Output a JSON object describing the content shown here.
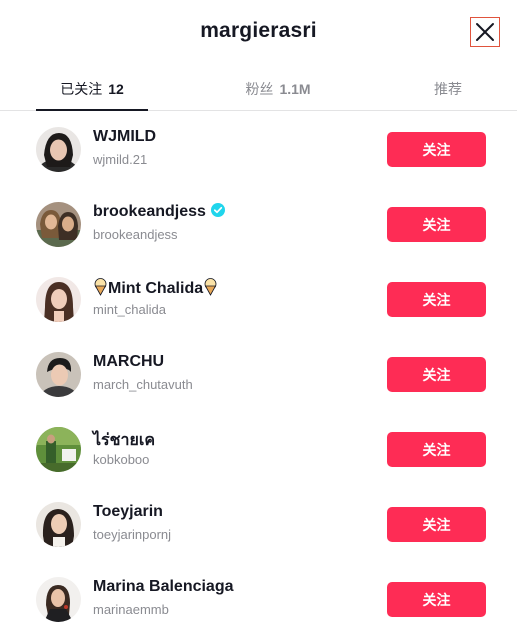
{
  "dialog": {
    "title": "margierasri",
    "close_icon": "close-icon"
  },
  "tabs": [
    {
      "label": "已关注",
      "count": "12",
      "active": true
    },
    {
      "label": "粉丝",
      "count": "1.1M",
      "active": false
    },
    {
      "label": "推荐",
      "count": "",
      "active": false
    }
  ],
  "users": [
    {
      "name": "WJMILD",
      "handle": "wjmild.21",
      "verified": false,
      "button": "关注"
    },
    {
      "name": "brookeandjess",
      "handle": "brookeandjess",
      "verified": true,
      "button": "关注"
    },
    {
      "name": "Mint Chalida",
      "handle": "mint_chalida",
      "verified": false,
      "button": "关注",
      "emoji": "ice-cream-icon"
    },
    {
      "name": "MARCHU",
      "handle": "march_chutavuth",
      "verified": false,
      "button": "关注"
    },
    {
      "name": "ไร่ชายเค",
      "handle": "kobkoboo",
      "verified": false,
      "button": "关注"
    },
    {
      "name": "Toeyjarin",
      "handle": "toeyjarinpornj",
      "verified": false,
      "button": "关注"
    },
    {
      "name": "Marina Balenciaga",
      "handle": "marinaemmb",
      "verified": false,
      "button": "关注"
    }
  ],
  "colors": {
    "follow_button": "#fe2c55",
    "verified_badge": "#20d5ec",
    "primary_text": "#161823",
    "secondary_text": "#8a8b91"
  }
}
